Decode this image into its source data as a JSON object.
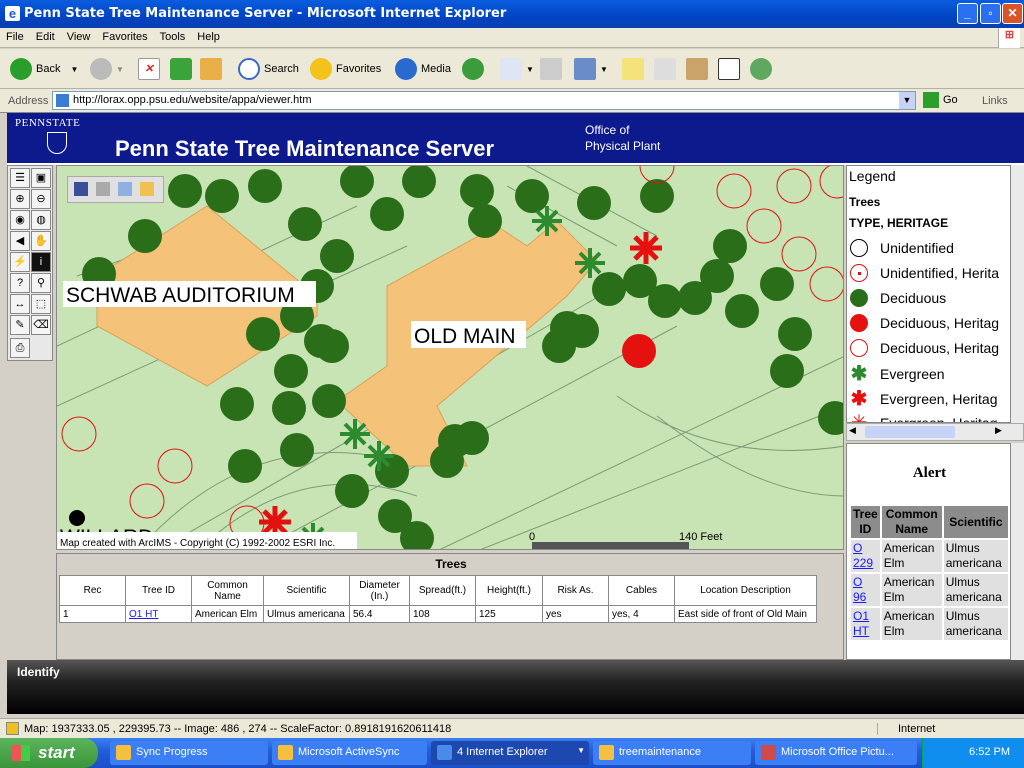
{
  "window": {
    "title": "Penn State Tree Maintenance Server - Microsoft Internet Explorer"
  },
  "menu": [
    "File",
    "Edit",
    "View",
    "Favorites",
    "Tools",
    "Help"
  ],
  "toolbar": {
    "back": "Back",
    "search": "Search",
    "favorites": "Favorites",
    "media": "Media"
  },
  "address": {
    "label": "Address",
    "url": "http://lorax.opp.psu.edu/website/appa/viewer.htm",
    "go": "Go",
    "links": "Links"
  },
  "banner": {
    "logo": "PENNSTATE",
    "title": "Penn State Tree Maintenance Server",
    "office_line1": "Office of",
    "office_line2": "Physical Plant"
  },
  "map": {
    "label_schwab": "SCHWAB AUDITORIUM",
    "label_oldmain": "OLD MAIN",
    "label_willard": "WILLARD",
    "copyright": "Map created with ArcIMS - Copyright (C) 1992-2002 ESRI Inc.",
    "scale_start": "0",
    "scale_end": "140 Feet"
  },
  "legend": {
    "title": "Legend",
    "layer": "Trees",
    "field": "TYPE, HERITAGE",
    "items": [
      {
        "label": "Unidentified",
        "symbol": "circle-outline-black"
      },
      {
        "label": "Unidentified, Herita",
        "symbol": "circle-outline-red-dot"
      },
      {
        "label": "Deciduous",
        "symbol": "circle-green"
      },
      {
        "label": "Deciduous, Heritag",
        "symbol": "circle-red"
      },
      {
        "label": "Deciduous, Heritag",
        "symbol": "circle-outline-red"
      },
      {
        "label": "Evergreen",
        "symbol": "star-green"
      },
      {
        "label": "Evergreen, Heritag",
        "symbol": "star-red"
      },
      {
        "label": "Evergreen, Heritag",
        "symbol": "star-red-outline"
      }
    ]
  },
  "alert": {
    "title": "Alert",
    "headers": [
      "Tree ID",
      "Common Name",
      "Scientific"
    ],
    "rows": [
      {
        "id": "O 229",
        "common": "American Elm",
        "sci": "Ulmus americana"
      },
      {
        "id": "O 96",
        "common": "American Elm",
        "sci": "Ulmus americana"
      },
      {
        "id": "O1 HT",
        "common": "American Elm",
        "sci": "Ulmus americana"
      }
    ]
  },
  "trees": {
    "title": "Trees",
    "headers": [
      "Rec",
      "Tree ID",
      "Common Name",
      "Scientific",
      "Diameter (In.)",
      "Spread(ft.)",
      "Height(ft.)",
      "Risk As.",
      "Cables",
      "Location Description"
    ],
    "rows": [
      [
        "1",
        "O1 HT",
        "American Elm",
        "Ulmus americana",
        "56.4",
        "108",
        "125",
        "yes",
        "yes, 4",
        "East side of front of Old Main"
      ]
    ]
  },
  "identify": "Identify",
  "status": {
    "text": "Map: 1937333.05 , 229395.73 -- Image: 486 , 274 -- ScaleFactor: 0.8918191620611418",
    "zone": "Internet"
  },
  "taskbar": {
    "start": "start",
    "tasks": [
      "Sync Progress",
      "Microsoft ActiveSync",
      "4 Internet Explorer",
      "treemaintenance",
      "Microsoft Office Pictu..."
    ],
    "clock": "6:52 PM"
  },
  "colors": {
    "deciduous": "#2a6e1a",
    "heritage": "#e51010",
    "building": "#f5c27a",
    "map_bg": "#c8e3b4",
    "banner": "#0c1a8d"
  }
}
